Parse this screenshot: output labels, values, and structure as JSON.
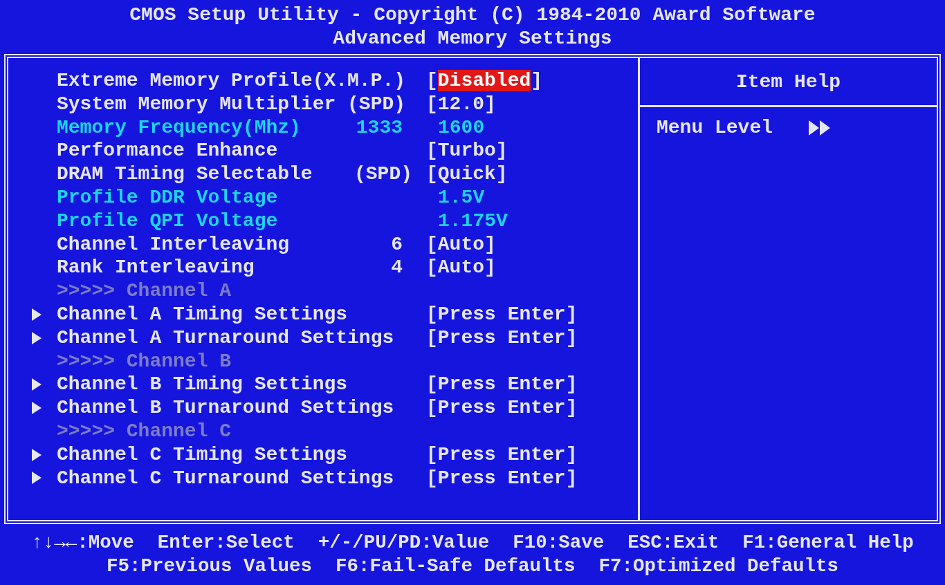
{
  "header": {
    "title": "CMOS Setup Utility - Copyright (C) 1984-2010 Award Software",
    "subtitle": "Advanced Memory Settings"
  },
  "settings": [
    {
      "kind": "option",
      "label": "Extreme Memory Profile(X.M.P.)",
      "value": "[Disabled]",
      "selected": true
    },
    {
      "kind": "option",
      "label": "System Memory Multiplier (SPD)",
      "value": "[12.0]",
      "selected": false
    },
    {
      "kind": "info",
      "label": "Memory Frequency(Mhz)",
      "middle": "1333",
      "value": "1600",
      "selected": false
    },
    {
      "kind": "option",
      "label": "Performance Enhance",
      "value": "[Turbo]",
      "selected": false
    },
    {
      "kind": "option",
      "label": "DRAM Timing Selectable",
      "middle": "(SPD)",
      "value": "[Quick]",
      "selected": false
    },
    {
      "kind": "info",
      "label": "Profile DDR Voltage",
      "value": "1.5V",
      "selected": false
    },
    {
      "kind": "info",
      "label": "Profile QPI Voltage",
      "value": "1.175V",
      "selected": false
    },
    {
      "kind": "option",
      "label": "Channel Interleaving",
      "middle": "6",
      "value": "[Auto]",
      "selected": false
    },
    {
      "kind": "option",
      "label": "Rank Interleaving",
      "middle": "4",
      "value": "[Auto]",
      "selected": false
    },
    {
      "kind": "separator",
      "label": ">>>>> Channel A",
      "selected": false
    },
    {
      "kind": "submenu",
      "label": "Channel A Timing Settings",
      "value": "[Press Enter]",
      "selected": false
    },
    {
      "kind": "submenu",
      "label": "Channel A Turnaround Settings",
      "value": "[Press Enter]",
      "selected": false
    },
    {
      "kind": "separator",
      "label": ">>>>> Channel B",
      "selected": false
    },
    {
      "kind": "submenu",
      "label": "Channel B Timing Settings",
      "value": "[Press Enter]",
      "selected": false
    },
    {
      "kind": "submenu",
      "label": "Channel B Turnaround Settings",
      "value": "[Press Enter]",
      "selected": false
    },
    {
      "kind": "separator",
      "label": ">>>>> Channel C",
      "selected": false
    },
    {
      "kind": "submenu",
      "label": "Channel C Timing Settings",
      "value": "[Press Enter]",
      "selected": false
    },
    {
      "kind": "submenu",
      "label": "Channel C Turnaround Settings",
      "value": "[Press Enter]",
      "selected": false
    }
  ],
  "help": {
    "title": "Item Help",
    "menu_level": "Menu Level"
  },
  "footer": [
    [
      "↑↓→←:Move",
      "Enter:Select",
      "+/-/PU/PD:Value",
      "F10:Save",
      "ESC:Exit",
      "F1:General Help"
    ],
    [
      "F5:Previous Values",
      "F6:Fail-Safe Defaults",
      "F7:Optimized Defaults"
    ]
  ]
}
